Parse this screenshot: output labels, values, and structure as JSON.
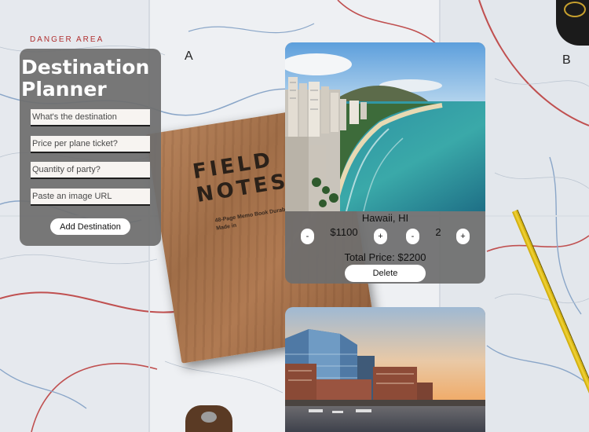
{
  "background": {
    "map_labels": {
      "danger_area": "DANGER AREA",
      "grid_a": "A",
      "grid_b": "B"
    },
    "notebook": {
      "title_line1": "FIELD",
      "title_line2": "NOTES",
      "subtitle": "48-Page Memo Book\nDurable Materials / Made in"
    }
  },
  "planner": {
    "title": "Destination Planner",
    "destination_placeholder": "What's the destination",
    "price_placeholder": "Price per plane ticket?",
    "quantity_placeholder": "Quantity of party?",
    "image_placeholder": "Paste an image URL",
    "add_label": "Add Destination"
  },
  "destinations": [
    {
      "name": "Hawaii, HI",
      "price": "$1100",
      "quantity": "2",
      "total_label": "Total Price: $2200",
      "decrement": "-",
      "increment": "+",
      "delete_label": "Delete"
    },
    {
      "name": "",
      "price": "",
      "quantity": "",
      "total_label": "",
      "delete_label": ""
    }
  ],
  "colors": {
    "panel": "#6e6e6e",
    "button": "#ffffff",
    "ocean": "#2f9aa3",
    "sky": "#8fc1e8"
  }
}
